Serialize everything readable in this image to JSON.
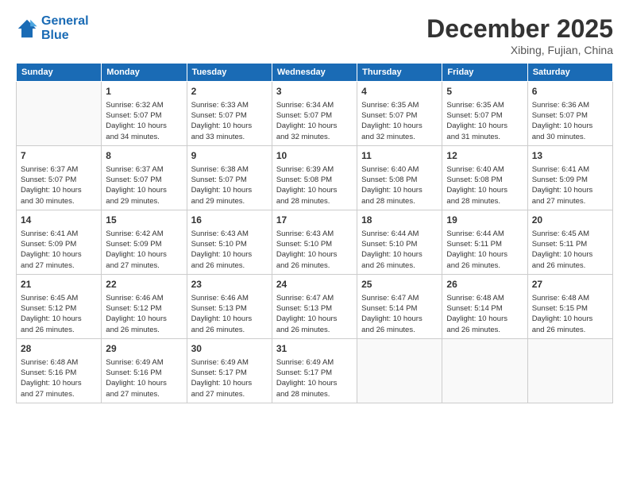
{
  "logo": {
    "line1": "General",
    "line2": "Blue"
  },
  "title": "December 2025",
  "location": "Xibing, Fujian, China",
  "headers": [
    "Sunday",
    "Monday",
    "Tuesday",
    "Wednesday",
    "Thursday",
    "Friday",
    "Saturday"
  ],
  "weeks": [
    [
      {
        "day": "",
        "info": ""
      },
      {
        "day": "1",
        "info": "Sunrise: 6:32 AM\nSunset: 5:07 PM\nDaylight: 10 hours\nand 34 minutes."
      },
      {
        "day": "2",
        "info": "Sunrise: 6:33 AM\nSunset: 5:07 PM\nDaylight: 10 hours\nand 33 minutes."
      },
      {
        "day": "3",
        "info": "Sunrise: 6:34 AM\nSunset: 5:07 PM\nDaylight: 10 hours\nand 32 minutes."
      },
      {
        "day": "4",
        "info": "Sunrise: 6:35 AM\nSunset: 5:07 PM\nDaylight: 10 hours\nand 32 minutes."
      },
      {
        "day": "5",
        "info": "Sunrise: 6:35 AM\nSunset: 5:07 PM\nDaylight: 10 hours\nand 31 minutes."
      },
      {
        "day": "6",
        "info": "Sunrise: 6:36 AM\nSunset: 5:07 PM\nDaylight: 10 hours\nand 30 minutes."
      }
    ],
    [
      {
        "day": "7",
        "info": "Sunrise: 6:37 AM\nSunset: 5:07 PM\nDaylight: 10 hours\nand 30 minutes."
      },
      {
        "day": "8",
        "info": "Sunrise: 6:37 AM\nSunset: 5:07 PM\nDaylight: 10 hours\nand 29 minutes."
      },
      {
        "day": "9",
        "info": "Sunrise: 6:38 AM\nSunset: 5:07 PM\nDaylight: 10 hours\nand 29 minutes."
      },
      {
        "day": "10",
        "info": "Sunrise: 6:39 AM\nSunset: 5:08 PM\nDaylight: 10 hours\nand 28 minutes."
      },
      {
        "day": "11",
        "info": "Sunrise: 6:40 AM\nSunset: 5:08 PM\nDaylight: 10 hours\nand 28 minutes."
      },
      {
        "day": "12",
        "info": "Sunrise: 6:40 AM\nSunset: 5:08 PM\nDaylight: 10 hours\nand 28 minutes."
      },
      {
        "day": "13",
        "info": "Sunrise: 6:41 AM\nSunset: 5:09 PM\nDaylight: 10 hours\nand 27 minutes."
      }
    ],
    [
      {
        "day": "14",
        "info": "Sunrise: 6:41 AM\nSunset: 5:09 PM\nDaylight: 10 hours\nand 27 minutes."
      },
      {
        "day": "15",
        "info": "Sunrise: 6:42 AM\nSunset: 5:09 PM\nDaylight: 10 hours\nand 27 minutes."
      },
      {
        "day": "16",
        "info": "Sunrise: 6:43 AM\nSunset: 5:10 PM\nDaylight: 10 hours\nand 26 minutes."
      },
      {
        "day": "17",
        "info": "Sunrise: 6:43 AM\nSunset: 5:10 PM\nDaylight: 10 hours\nand 26 minutes."
      },
      {
        "day": "18",
        "info": "Sunrise: 6:44 AM\nSunset: 5:10 PM\nDaylight: 10 hours\nand 26 minutes."
      },
      {
        "day": "19",
        "info": "Sunrise: 6:44 AM\nSunset: 5:11 PM\nDaylight: 10 hours\nand 26 minutes."
      },
      {
        "day": "20",
        "info": "Sunrise: 6:45 AM\nSunset: 5:11 PM\nDaylight: 10 hours\nand 26 minutes."
      }
    ],
    [
      {
        "day": "21",
        "info": "Sunrise: 6:45 AM\nSunset: 5:12 PM\nDaylight: 10 hours\nand 26 minutes."
      },
      {
        "day": "22",
        "info": "Sunrise: 6:46 AM\nSunset: 5:12 PM\nDaylight: 10 hours\nand 26 minutes."
      },
      {
        "day": "23",
        "info": "Sunrise: 6:46 AM\nSunset: 5:13 PM\nDaylight: 10 hours\nand 26 minutes."
      },
      {
        "day": "24",
        "info": "Sunrise: 6:47 AM\nSunset: 5:13 PM\nDaylight: 10 hours\nand 26 minutes."
      },
      {
        "day": "25",
        "info": "Sunrise: 6:47 AM\nSunset: 5:14 PM\nDaylight: 10 hours\nand 26 minutes."
      },
      {
        "day": "26",
        "info": "Sunrise: 6:48 AM\nSunset: 5:14 PM\nDaylight: 10 hours\nand 26 minutes."
      },
      {
        "day": "27",
        "info": "Sunrise: 6:48 AM\nSunset: 5:15 PM\nDaylight: 10 hours\nand 26 minutes."
      }
    ],
    [
      {
        "day": "28",
        "info": "Sunrise: 6:48 AM\nSunset: 5:16 PM\nDaylight: 10 hours\nand 27 minutes."
      },
      {
        "day": "29",
        "info": "Sunrise: 6:49 AM\nSunset: 5:16 PM\nDaylight: 10 hours\nand 27 minutes."
      },
      {
        "day": "30",
        "info": "Sunrise: 6:49 AM\nSunset: 5:17 PM\nDaylight: 10 hours\nand 27 minutes."
      },
      {
        "day": "31",
        "info": "Sunrise: 6:49 AM\nSunset: 5:17 PM\nDaylight: 10 hours\nand 28 minutes."
      },
      {
        "day": "",
        "info": ""
      },
      {
        "day": "",
        "info": ""
      },
      {
        "day": "",
        "info": ""
      }
    ]
  ]
}
